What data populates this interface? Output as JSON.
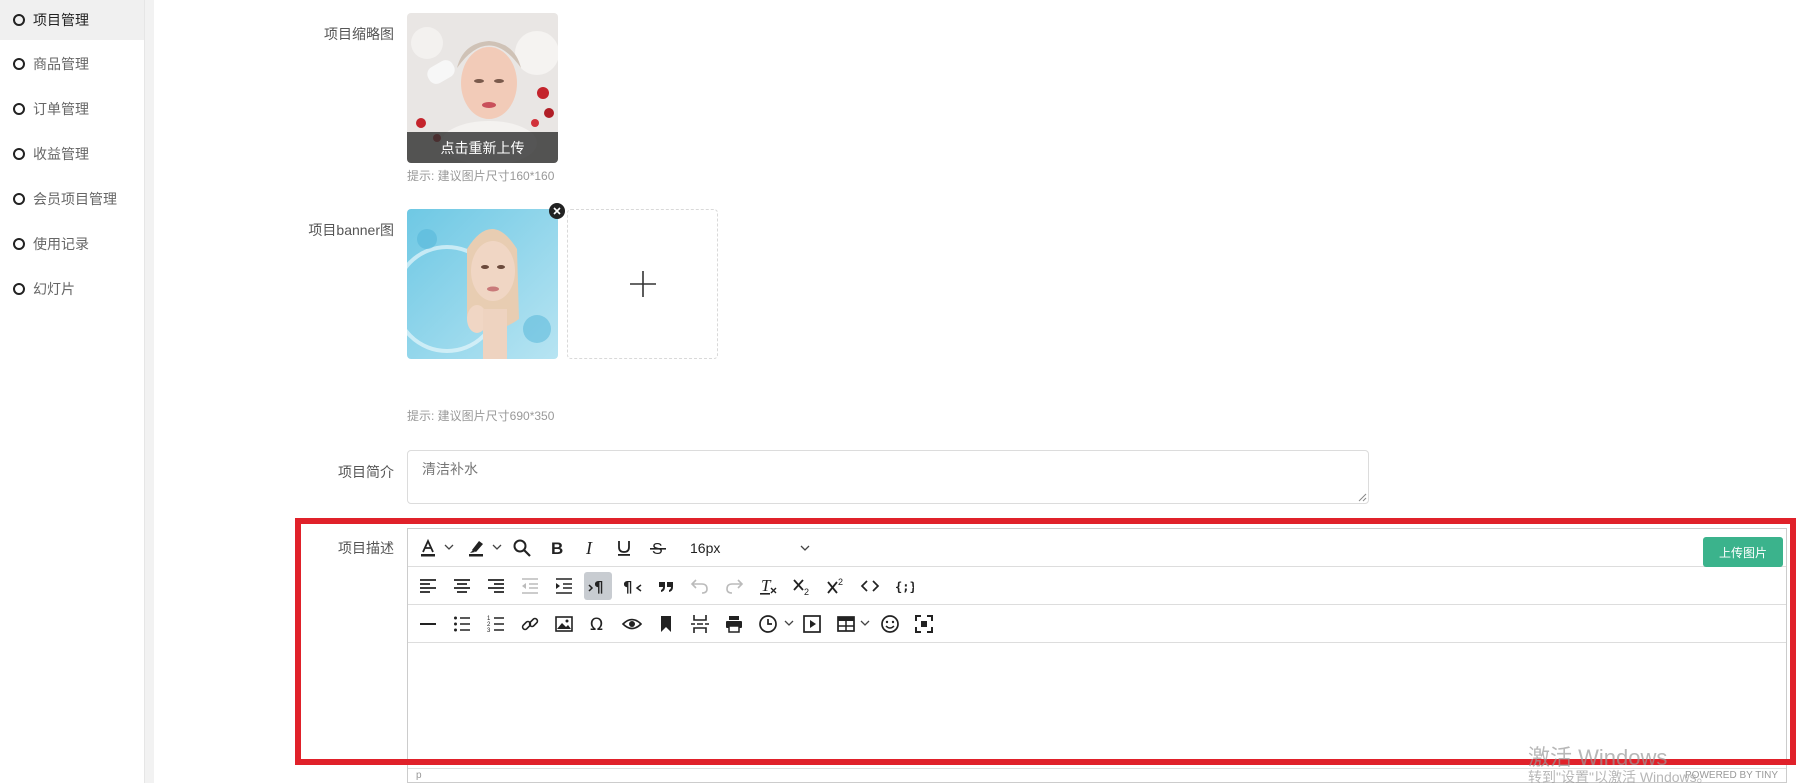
{
  "sidebar": {
    "items": [
      {
        "label": "项目管理",
        "active": true
      },
      {
        "label": "商品管理",
        "active": false
      },
      {
        "label": "订单管理",
        "active": false
      },
      {
        "label": "收益管理",
        "active": false
      },
      {
        "label": "会员项目管理",
        "active": false
      },
      {
        "label": "使用记录",
        "active": false
      },
      {
        "label": "幻灯片",
        "active": false
      }
    ]
  },
  "form": {
    "thumbnail": {
      "label": "项目缩略图",
      "overlay_text": "点击重新上传",
      "tip": "提示: 建议图片尺寸160*160"
    },
    "banner": {
      "label": "项目banner图",
      "tip": "提示: 建议图片尺寸690*350"
    },
    "summary": {
      "label": "项目简介",
      "value": "清洁补水"
    },
    "description": {
      "label": "项目描述",
      "font_size": "16px",
      "upload_button": "上传图片",
      "statusbar_path": "p",
      "powered_by": "POWERED BY TINY"
    }
  },
  "watermark": {
    "line1": "激活 Windows",
    "line2": "转到\"设置\"以激活 Windows。"
  },
  "colors": {
    "accent_green": "#3bb38c",
    "highlight_red": "#e0212a"
  }
}
